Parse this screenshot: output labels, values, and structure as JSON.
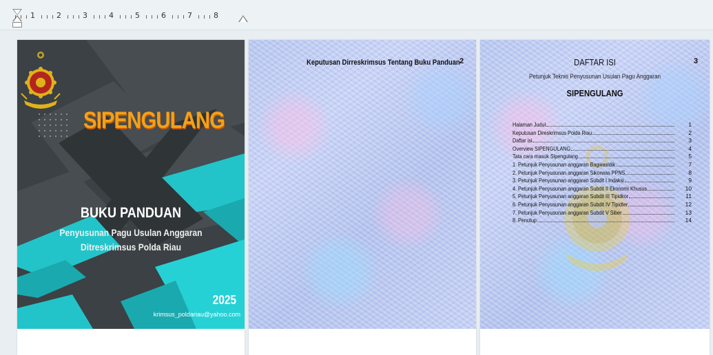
{
  "ruler": {
    "numbers": [
      "1",
      "2",
      "3",
      "4",
      "5",
      "6",
      "7",
      "8"
    ]
  },
  "pages": {
    "cover": {
      "title": "SIPENGULANG",
      "heading": "BUKU PANDUAN",
      "subtitle_line1": "Penyusunan Pagu Usulan Anggaran",
      "subtitle_line2": "Ditreskrimsus Polda Riau",
      "year": "2025",
      "email": "krimsus_poldariau@yahoo.com",
      "colors": {
        "accent": "#f2a11a",
        "teal": "#22c4c9",
        "dark": "#3b4144"
      },
      "logo_icon": "police-emblem-icon"
    },
    "page2": {
      "heading": "Keputusan Dirreskrimsus Tentang Buku Panduan",
      "page_number": "2"
    },
    "page3": {
      "title": "DAFTAR ISI",
      "page_number": "3",
      "subtitle": "Petunjuk Teknis Penyusunan Usulan Pagu Anggaran",
      "brand": "SIPENGULANG",
      "toc": [
        {
          "label": "Halaman Judul",
          "page": "1"
        },
        {
          "label": "Keputusan Direskrimsus Polda Riau",
          "page": "2"
        },
        {
          "label": "Daftar isi",
          "page": "3"
        },
        {
          "label": "Overview SIPENGULANG",
          "page": "4"
        },
        {
          "label": "Tata cara masuk Sipengulang",
          "page": "5"
        },
        {
          "label": "1. Petunjuk Penyusunan anggaran Bagwasidik",
          "page": "7"
        },
        {
          "label": "2. Petunjuk Penyusunan anggaran Sikorwas PPNS",
          "page": "8"
        },
        {
          "label": "3. Petunjuk Penyusunan anggaran Subdit I Indaksi",
          "page": "9"
        },
        {
          "label": "4. Petunjuk Penyusunan anggaran Subdit II Ekonomi Khusus",
          "page": "10"
        },
        {
          "label": "5. Petunjuk Penyusunan anggaran Subdit III Tipidkor",
          "page": "11"
        },
        {
          "label": "6. Petunjuk Penyusunan anggaran Subdit IV Tipidter",
          "page": "12"
        },
        {
          "label": "7. Petunjuk Penyusunan anggaran Subdit V Siber",
          "page": "13"
        },
        {
          "label": "8. Penutup",
          "page": "14"
        }
      ]
    }
  }
}
